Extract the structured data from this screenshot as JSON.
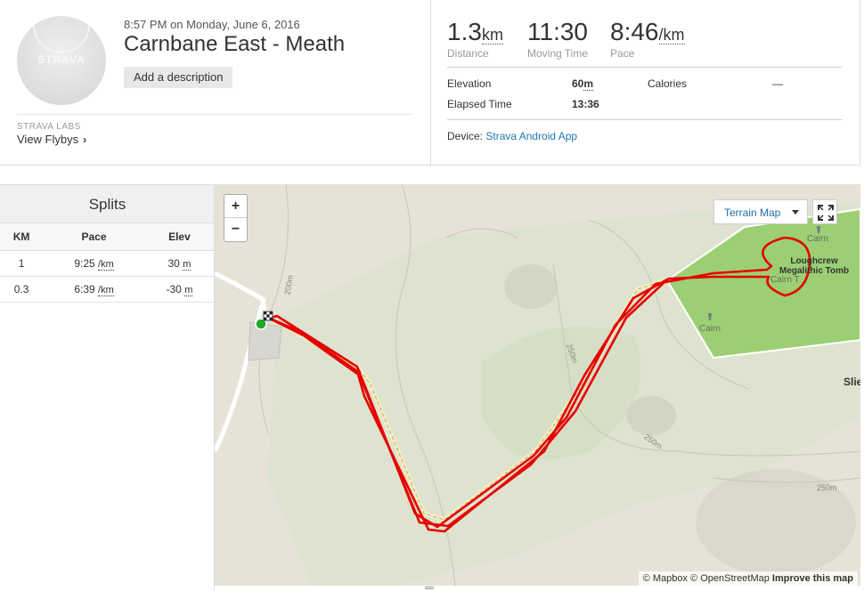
{
  "activity": {
    "date_line": "8:57 PM on Monday, June 6, 2016",
    "title": "Carnbane East - Meath",
    "add_description": "Add a description",
    "avatar_logo": "STRAVA",
    "labs_label": "STRAVA LABS",
    "flybys_link": "View Flybys"
  },
  "stats": {
    "distance": {
      "value": "1.3",
      "unit": "km",
      "label": "Distance"
    },
    "moving_time": {
      "value": "11:30",
      "label": "Moving Time"
    },
    "pace": {
      "value": "8:46",
      "unit": "/km",
      "label": "Pace"
    },
    "elevation_label": "Elevation",
    "elevation_value": "60",
    "elevation_unit": "m",
    "calories_label": "Calories",
    "calories_value": "—",
    "elapsed_label": "Elapsed Time",
    "elapsed_value": "13:36",
    "device_label": "Device:",
    "device_value": "Strava Android App"
  },
  "splits": {
    "title": "Splits",
    "columns": [
      "KM",
      "Pace",
      "Elev"
    ],
    "rows": [
      {
        "km": "1",
        "pace": "9:25",
        "pace_unit": "/km",
        "elev": "30",
        "elev_unit": "m"
      },
      {
        "km": "0.3",
        "pace": "6:39",
        "pace_unit": "/km",
        "elev": "-30",
        "elev_unit": "m"
      }
    ]
  },
  "map": {
    "zoom_in": "+",
    "zoom_out": "−",
    "terrain_button": "Terrain Map",
    "attribution_mapbox": "© Mapbox",
    "attribution_osm": "© OpenStreetMap",
    "attribution_improve": "Improve this map",
    "contours": [
      "200m",
      "250m",
      "250m",
      "250m"
    ],
    "poi_cairn_1": "Cairn",
    "poi_cairn_2": "Cairn",
    "poi_cairn_t": "Cairn T",
    "poi_loughcrew_1": "Loughcrew",
    "poi_loughcrew_2": "Megalithic Tomb",
    "place_partial": "Slie",
    "route_color": "#e60000",
    "park_color": "#9ccf74"
  }
}
